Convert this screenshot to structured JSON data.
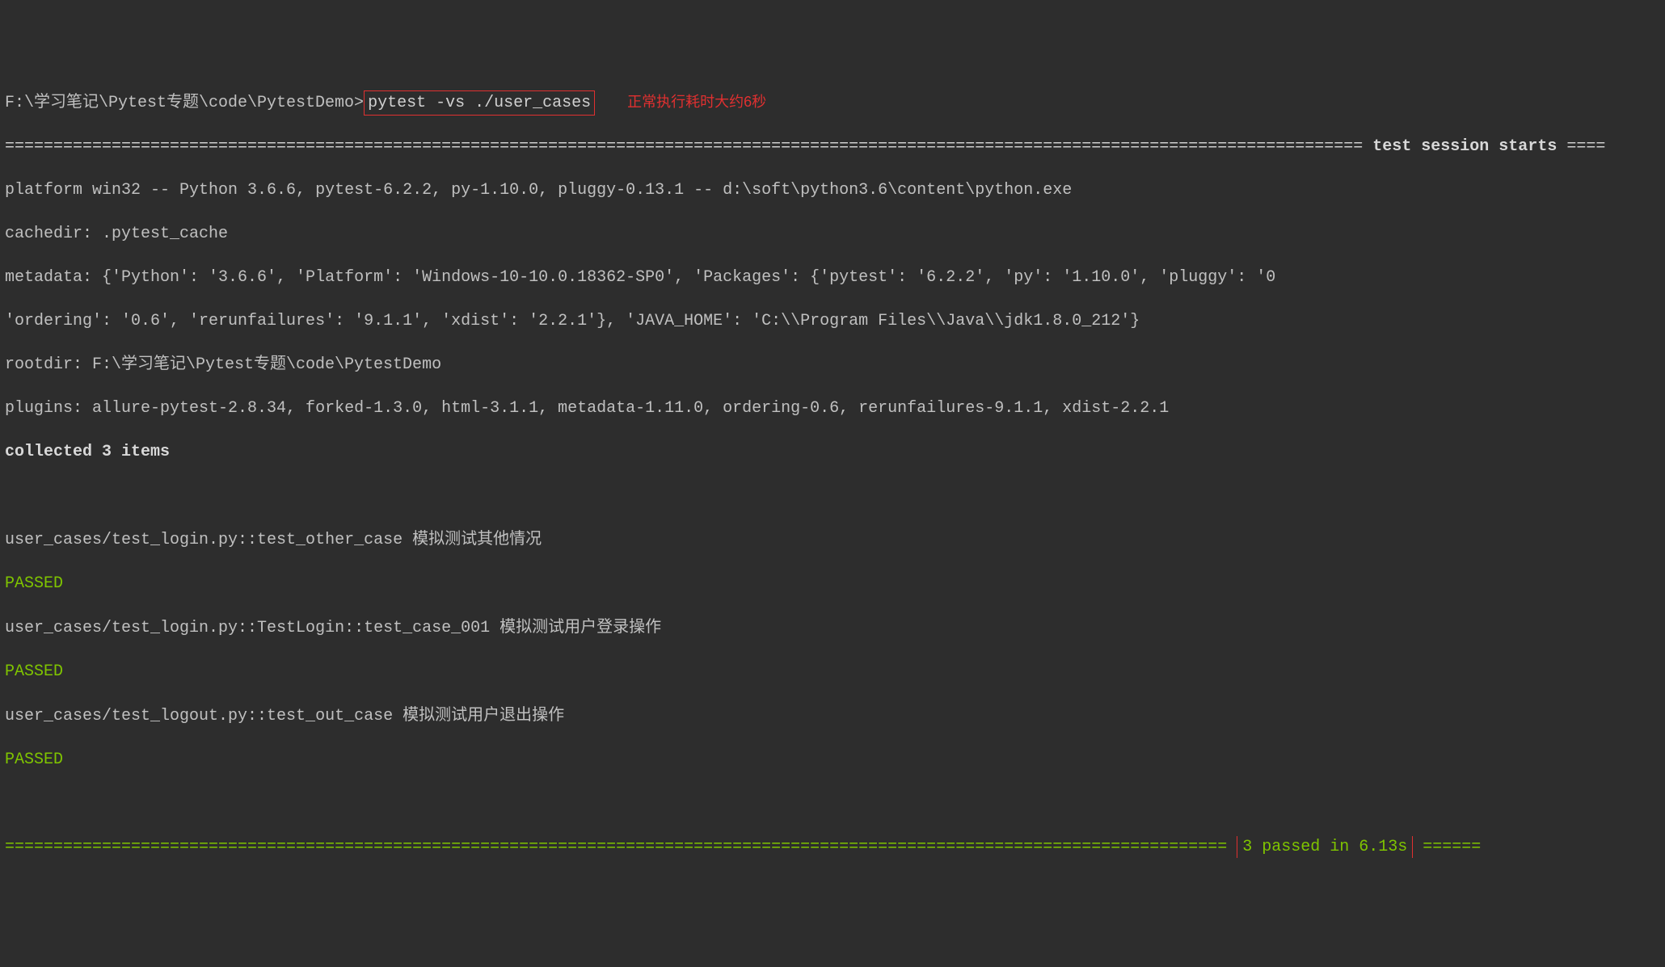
{
  "prompt": {
    "path": "F:\\学习笔记\\Pytest专题\\code\\PytestDemo>",
    "command": "pytest -vs ./user_cases",
    "annotation": "正常执行耗时大约6秒"
  },
  "session": {
    "header_divider_left": "============================================================================================================================================ ",
    "header_label": "test session starts",
    "header_divider_right": " ====",
    "platform": "platform win32 -- Python 3.6.6, pytest-6.2.2, py-1.10.0, pluggy-0.13.1 -- d:\\soft\\python3.6\\content\\python.exe",
    "cachedir": "cachedir: .pytest_cache",
    "metadata1": "metadata: {'Python': '3.6.6', 'Platform': 'Windows-10-10.0.18362-SP0', 'Packages': {'pytest': '6.2.2', 'py': '1.10.0', 'pluggy': '0",
    "metadata2": "'ordering': '0.6', 'rerunfailures': '9.1.1', 'xdist': '2.2.1'}, 'JAVA_HOME': 'C:\\\\Program Files\\\\Java\\\\jdk1.8.0_212'}",
    "rootdir": "rootdir: F:\\学习笔记\\Pytest专题\\code\\PytestDemo",
    "plugins": "plugins: allure-pytest-2.8.34, forked-1.3.0, html-3.1.1, metadata-1.11.0, ordering-0.6, rerunfailures-9.1.1, xdist-2.2.1",
    "collected": "collected 3 items"
  },
  "tests": [
    {
      "id": "user_cases/test_login.py::test_other_case ",
      "desc": "模拟测试其他情况",
      "result": "PASSED"
    },
    {
      "id": "user_cases/test_login.py::TestLogin::test_case_001 ",
      "desc": "模拟测试用户登录操作",
      "result": "PASSED"
    },
    {
      "id": "user_cases/test_logout.py::test_out_case ",
      "desc": "模拟测试用户退出操作",
      "result": "PASSED"
    }
  ],
  "summary": {
    "divider_left": "============================================================================================================================== ",
    "text": "3 passed in 6.13s",
    "divider_right": " ======"
  }
}
